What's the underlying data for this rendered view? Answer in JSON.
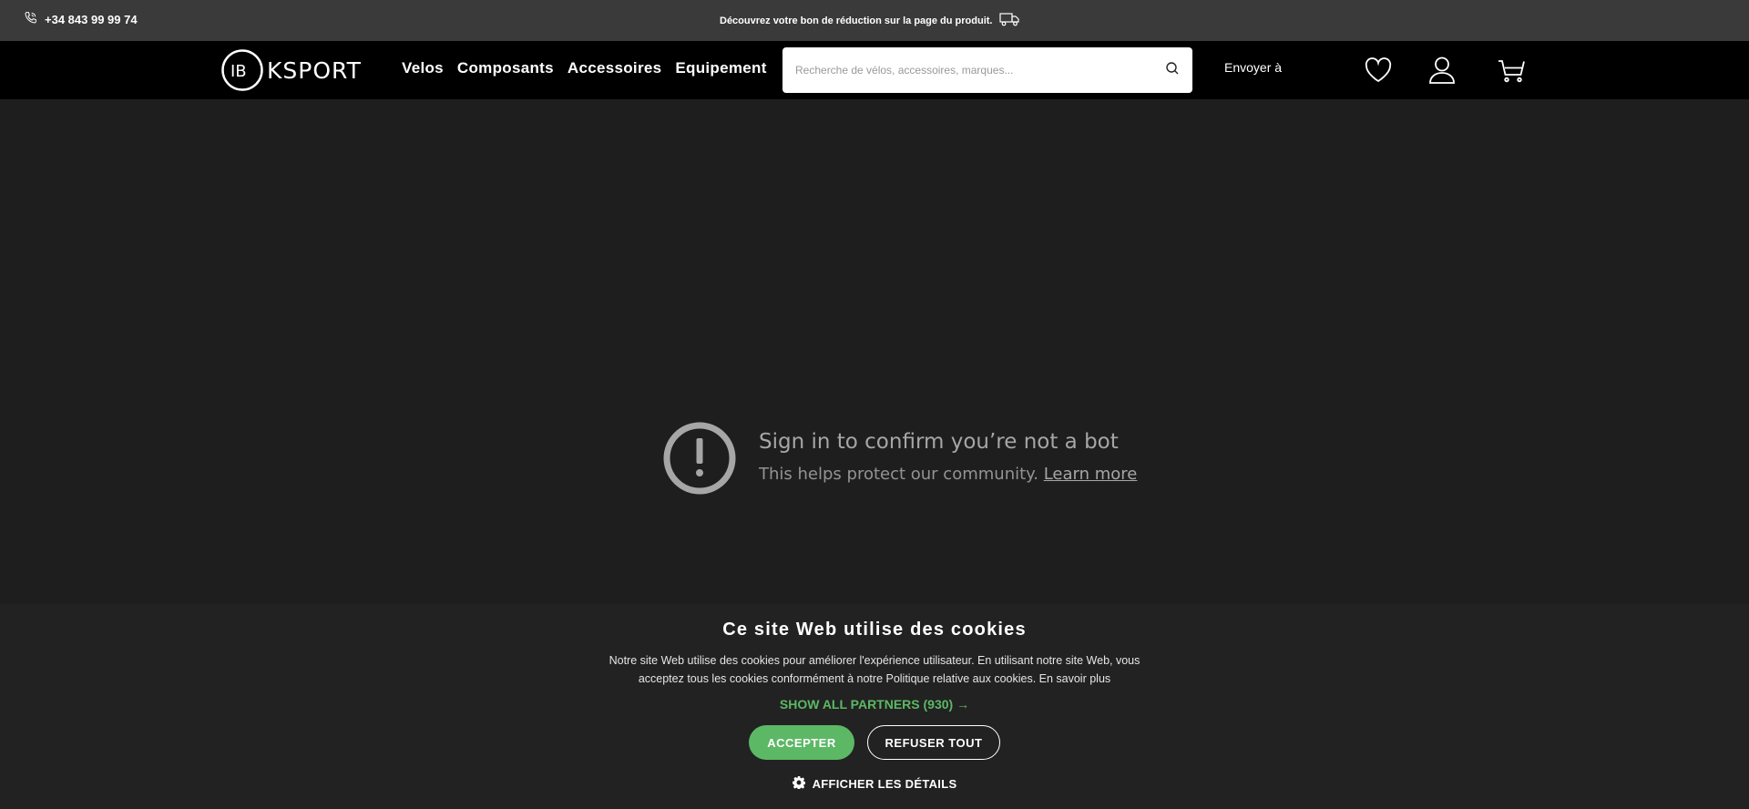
{
  "topbar": {
    "phone": "+34 843 99 99 74",
    "promo": "Découvrez votre bon de réduction sur la page du produit."
  },
  "navbar": {
    "logo": "IBKSPORT",
    "items": [
      {
        "label": "Velos"
      },
      {
        "label": "Composants"
      },
      {
        "label": "Accessoires"
      },
      {
        "label": "Equipement"
      }
    ],
    "search_placeholder": "Recherche de vélos, accessoires, marques...",
    "ship_to": "Envoyer à"
  },
  "bot_check": {
    "title": "Sign in to confirm you’re not a bot",
    "subtitle": "This helps protect our community.",
    "link": "Learn more"
  },
  "cookie_banner": {
    "title": "Ce site Web utilise des cookies",
    "text": "Notre site Web utilise des cookies pour améliorer l'expérience utilisateur. En utilisant notre site Web, vous acceptez tous les cookies conformément à notre Politique relative aux cookies. En savoir plus",
    "partners": "SHOW ALL PARTNERS (930) →",
    "accept": "ACCEPTER",
    "refuse": "REFUSER TOUT",
    "details": "AFFICHER LES DÉTAILS"
  },
  "colors": {
    "accent": "#5cb865",
    "topbar": "#3a3a3a",
    "navbar": "#000000",
    "background": "#1e1e1e"
  }
}
